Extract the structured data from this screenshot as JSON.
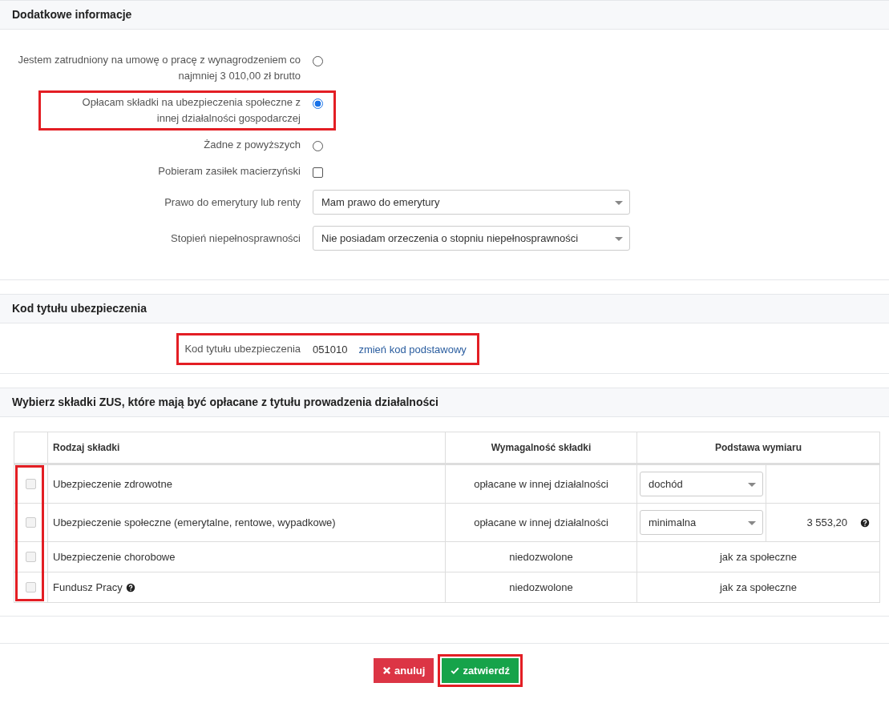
{
  "additional_info": {
    "title": "Dodatkowe informacje",
    "options": [
      {
        "kind": "radio",
        "label": "Jestem zatrudniony na umowę o pracę z wynagrodzeniem co najmniej 3 010,00 zł brutto",
        "selected": false,
        "highlighted": false
      },
      {
        "kind": "radio",
        "label": "Opłacam składki na ubezpieczenia społeczne z innej działalności gospodarczej",
        "selected": true,
        "highlighted": true
      },
      {
        "kind": "radio",
        "label": "Żadne z powyższych",
        "selected": false,
        "highlighted": false
      },
      {
        "kind": "checkbox",
        "label": "Pobieram zasiłek macierzyński",
        "checked": false,
        "highlighted": false
      }
    ],
    "selects": [
      {
        "label": "Prawo do emerytury lub renty",
        "value": "Mam prawo do emerytury"
      },
      {
        "label": "Stopień niepełnosprawności",
        "value": "Nie posiadam orzeczenia o stopniu niepełnosprawności"
      }
    ]
  },
  "insurance_code": {
    "title": "Kod tytułu ubezpieczenia",
    "label": "Kod tytułu ubezpieczenia",
    "code": "051010",
    "link": "zmień kod podstawowy",
    "highlighted": true
  },
  "contributions": {
    "title": "Wybierz składki ZUS, które mają być opłacane z tytułu prowadzenia działalności",
    "columns": [
      "Rodzaj składki",
      "Wymagalność składki",
      "Podstawa wymiaru"
    ],
    "checkbox_column_highlighted": true,
    "rows": [
      {
        "kind": "select",
        "name": "Ubezpieczenie zdrowotne",
        "help": false,
        "checked": false,
        "disabled": true,
        "requirement": "opłacane w innej działalności",
        "basis": "dochód"
      },
      {
        "kind": "select",
        "name": "Ubezpieczenie społeczne (emerytalne, rentowe, wypadkowe)",
        "help": false,
        "checked": false,
        "disabled": true,
        "requirement": "opłacane w innej działalności",
        "basis": "minimalna",
        "amount": "3 553,20",
        "amount_help": true
      },
      {
        "kind": "text",
        "name": "Ubezpieczenie chorobowe",
        "help": false,
        "checked": false,
        "disabled": true,
        "requirement": "niedozwolone",
        "basis": "jak za społeczne"
      },
      {
        "kind": "text",
        "name": "Fundusz Pracy",
        "help": true,
        "checked": false,
        "disabled": true,
        "requirement": "niedozwolone",
        "basis": "jak za społeczne"
      }
    ]
  },
  "buttons": [
    {
      "kind": "cancel",
      "label": "anuluj",
      "highlighted": false
    },
    {
      "kind": "confirm",
      "label": "zatwierdź",
      "highlighted": true
    }
  ]
}
